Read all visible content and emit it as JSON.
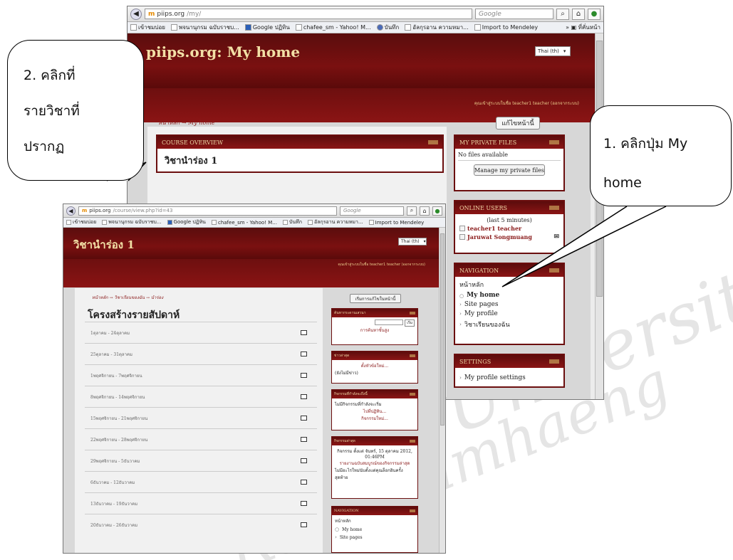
{
  "watermark": {
    "line1": "University",
    "line2": "Ramkhamhaeng"
  },
  "back_window": {
    "url_host": "piips.org",
    "url_path": "/my/",
    "search_placeholder": "Google",
    "bookmarks": [
      "เข้าชมบ่อย",
      "พจนานุกรม ฉบับราชบ...",
      "Google ปฏิทิน",
      "chafee_sm - Yahoo! M...",
      "บันทึก",
      "อัลกุรอาน ความหมา...",
      "Import to Mendeley"
    ],
    "bookmarks_more": "ที่คั่นหน้า",
    "site_title": "piips.org: My home",
    "language": "Thai (th)",
    "login_info": "คุณเข้าสู่ระบบในชื่อ teacher1 teacher (ออกจากระบบ)",
    "breadcrumb_home": "หน้าหลัก",
    "breadcrumb_sep": "→",
    "breadcrumb_current": "My home",
    "edit_button": "แก้ไขหน้านี้",
    "course_overview": {
      "title": "COURSE OVERVIEW",
      "course": "วิชานำร่อง 1"
    },
    "private_files": {
      "title": "MY PRIVATE FILES",
      "empty": "No files available",
      "button": "Manage my private files"
    },
    "online_users": {
      "title": "ONLINE USERS",
      "period": "(last 5 minutes)",
      "users": [
        "teacher1 teacher",
        "Jaruwat Songmuang"
      ]
    },
    "navigation": {
      "title": "NAVIGATION",
      "root": "หน้าหลัก",
      "items": [
        "My home",
        "Site pages",
        "My profile",
        "วิชาเรียนของฉัน"
      ]
    },
    "settings": {
      "title": "SETTINGS",
      "items": [
        "My profile settings"
      ]
    }
  },
  "front_window": {
    "url_host": "piips.org",
    "url_path": "/course/view.php?id=43",
    "search_placeholder": "Google",
    "bookmarks": [
      "เข้าชมบ่อย",
      "พจนานุกรม ฉบับราชบ...",
      "Google ปฏิทิน",
      "chafee_sm - Yahoo! M...",
      "บันทึก",
      "อัลกุรอาน ความหมา...",
      "Import to Mendeley"
    ],
    "site_title": "วิชานำร่อง 1",
    "language": "Thai (th)",
    "login_info": "คุณเข้าสู่ระบบในชื่อ teacher1 teacher (ออกจากระบบ)",
    "breadcrumb": "หน้าหลัก → วิชาเรียนของฉัน → นำร่อง",
    "edit_button": "เริ่มการแก้ไขในหน้านี้",
    "heading": "โครงสร้างรายสัปดาห์",
    "weeks": [
      "1ตุลาคม - 24ตุลาคม",
      "25ตุลาคม - 31ตุลาคม",
      "1พฤศจิกายน - 7พฤศจิกายน",
      "8พฤศจิกายน - 14พฤศจิกายน",
      "15พฤศจิกายน - 21พฤศจิกายน",
      "22พฤศจิกายน - 28พฤศจิกายน",
      "29พฤศจิกายน - 5ธันวาคม",
      "6ธันวาคม - 12ธันวาคม",
      "13ธันวาคม - 19ธันวาคม",
      "20ธันวาคม - 26ธันวาคม"
    ],
    "blocks": {
      "search": {
        "title": "ค้นหากระดานเสวนา",
        "go": "เริ่ม",
        "advanced": "การค้นหาขั้นสูง"
      },
      "news": {
        "title": "ข่าวล่าสุด",
        "add": "ตั้งหัวข้อใหม่...",
        "none": "(ยังไม่มีข่าว)"
      },
      "upcoming": {
        "title": "กิจกรรมที่กำลังจะถึงนี้",
        "none": "ไม่มีกิจกรรมที่กำลังจะเริ่ม",
        "calendar": "ไปที่ปฏิทิน...",
        "new_event": "กิจกรรมใหม่..."
      },
      "recent": {
        "title": "กิจกรรมล่าสุด",
        "since": "กิจกรรม ตั้งแต่ จันทร์, 15 ตุลาคม 2012, 01:46PM",
        "full": "รายงานฉบับสมบูรณ์ของกิจกรรมล่าสุด",
        "none": "ไม่มีอะไรใหม่นับตั้งแต่คุณล็อกอินครั้งสุดท้าย"
      },
      "navigation": {
        "title": "NAVIGATION",
        "root": "หน้าหลัก",
        "items": [
          "My home",
          "Site pages"
        ]
      }
    }
  },
  "callouts": {
    "step2": {
      "line1": "2. คลิกที่",
      "line2": "รายวิชาที่",
      "line3": "ปรากฏ"
    },
    "step1": {
      "line1": "1. คลิกปุ่ม My",
      "line2": "home"
    }
  }
}
